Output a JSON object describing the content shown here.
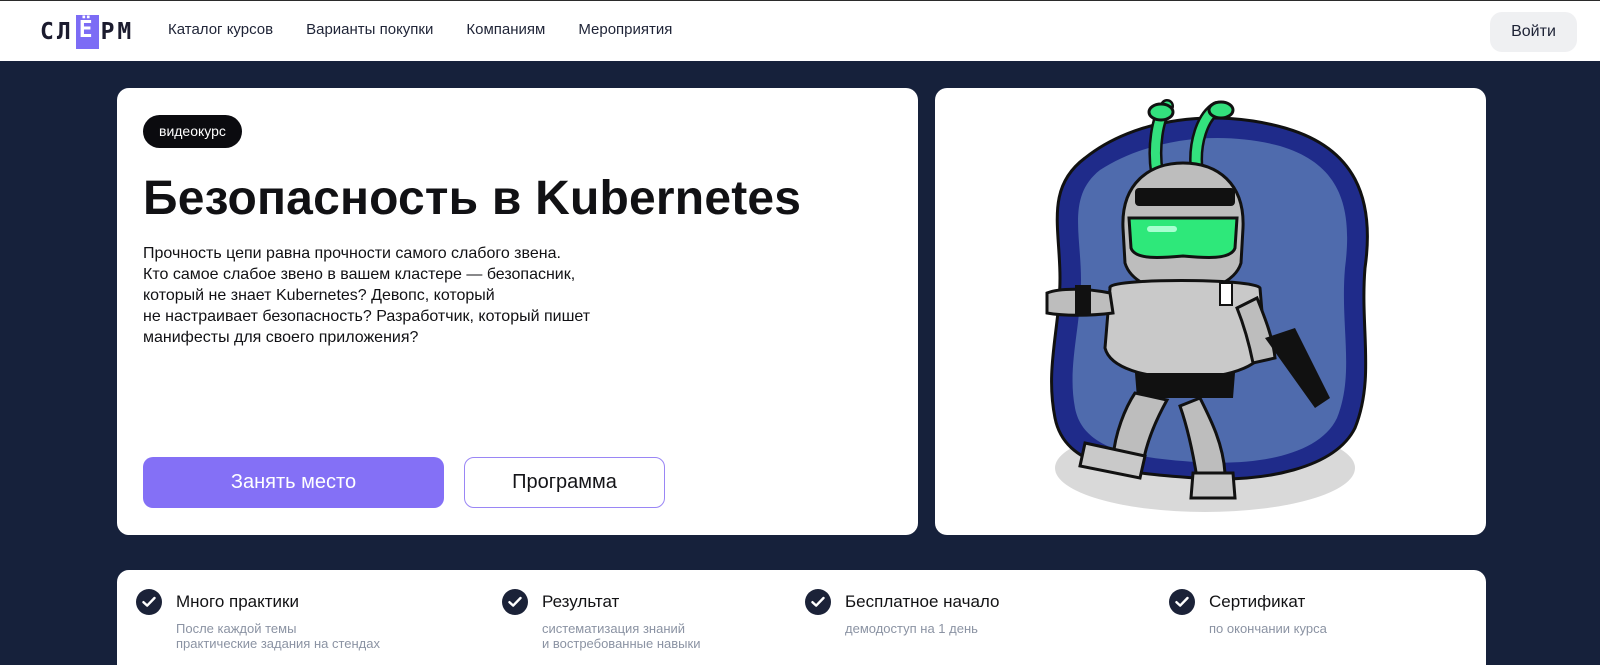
{
  "header": {
    "logo": {
      "pre": "СЛ",
      "accent": "Ё",
      "post": "РМ"
    },
    "nav": [
      "Каталог курсов",
      "Варианты покупки",
      "Компаниям",
      "Мероприятия"
    ],
    "login_label": "Войти"
  },
  "hero": {
    "badge": "видеокурс",
    "title": "Безопасность в Kubernetes",
    "description_lines": [
      "Прочность цепи равна прочности самого слабого звена.",
      "Кто самое слабое звено в вашем кластере — безопасник,",
      "который не знает Kubernetes? Девопс, который",
      "не настраивает безопасность? Разработчик, который пишет",
      "манифесты для своего приложения?"
    ],
    "primary_button": "Занять место",
    "secondary_button": "Программа"
  },
  "illustration": {
    "subject": "robot-mascot"
  },
  "features": [
    {
      "title": "Много практики",
      "subtitle": [
        "После каждой темы",
        "практические задания на стендах"
      ]
    },
    {
      "title": "Результат",
      "subtitle": [
        "систематизация знаний",
        "и востребованные навыки"
      ]
    },
    {
      "title": "Бесплатное начало",
      "subtitle": [
        "демодоступ на 1 день"
      ]
    },
    {
      "title": "Сертификат",
      "subtitle": [
        "по окончании курса"
      ]
    }
  ],
  "colors": {
    "page_background": "#16213b",
    "accent_purple": "#8470f6",
    "check_circle": "#1b2238",
    "robot_visor": "#2ee87a"
  },
  "icons": {
    "check": "check-icon"
  }
}
